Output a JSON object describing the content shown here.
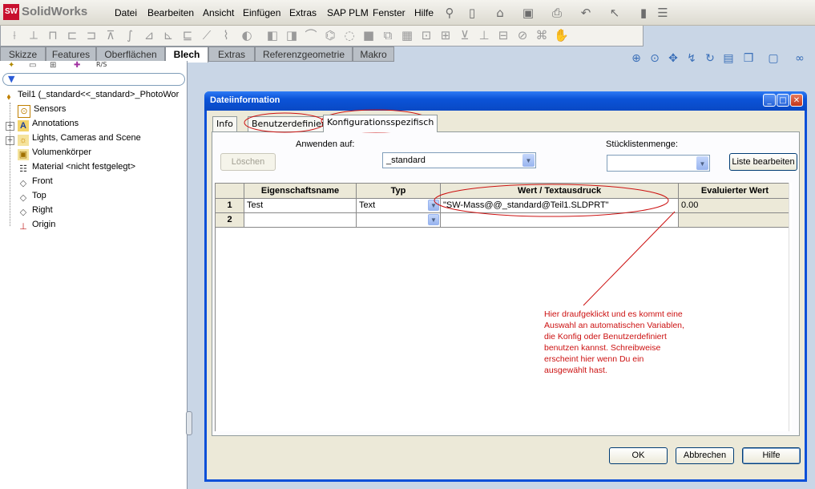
{
  "app": {
    "logo_text": "SolidWorks",
    "logo_mark": "SW"
  },
  "menu": [
    "Datei",
    "Bearbeiten",
    "Ansicht",
    "Einfügen",
    "Extras",
    "SAP PLM",
    "Fenster",
    "Hilfe"
  ],
  "command_tabs": [
    "Skizze",
    "Features",
    "Oberflächen",
    "Blech",
    "Extras",
    "Referenzgeometrie",
    "Makro"
  ],
  "command_tab_active": "Blech",
  "tree": {
    "root": "Teil1  (_standard<<_standard>_PhotoWor",
    "items": [
      {
        "label": "Sensors",
        "icon": "sensors-icon"
      },
      {
        "label": "Annotations",
        "icon": "annotations-icon"
      },
      {
        "label": "Lights, Cameras and Scene",
        "icon": "lights-icon"
      },
      {
        "label": "Volumenkörper",
        "icon": "solid-bodies-icon"
      },
      {
        "label": "Material <nicht festgelegt>",
        "icon": "material-icon"
      },
      {
        "label": "Front",
        "icon": "plane-icon"
      },
      {
        "label": "Top",
        "icon": "plane-icon"
      },
      {
        "label": "Right",
        "icon": "plane-icon"
      },
      {
        "label": "Origin",
        "icon": "origin-icon"
      }
    ]
  },
  "dialog": {
    "title": "Dateiinformation",
    "tabs": [
      "Info",
      "Benutzerdefiniert",
      "Konfigurationsspezifisch"
    ],
    "active_tab": "Konfigurationsspezifisch",
    "delete_button": "Löschen",
    "apply_to_label": "Anwenden auf:",
    "apply_to_value": "_standard",
    "bom_quantity_label": "Stücklistenmenge:",
    "bom_quantity_value": "",
    "edit_list_button": "Liste bearbeiten",
    "columns": [
      "Eigenschaftsname",
      "Typ",
      "Wert / Textausdruck",
      "Evaluierter Wert"
    ],
    "rows": [
      {
        "num": "1",
        "name": "Test",
        "type": "Text",
        "value": "\"SW-Mass@@_standard@Teil1.SLDPRT\"",
        "evaluated": "0.00"
      },
      {
        "num": "2",
        "name": "",
        "type": "",
        "value": "",
        "evaluated": ""
      }
    ],
    "ok_button": "OK",
    "cancel_button": "Abbrechen",
    "help_button": "Hilfe"
  },
  "annotation": {
    "lines": [
      "Hier draufgeklickt und es kommt eine",
      "Auswahl an automatischen Variablen,",
      "die Konfig oder Benutzerdefiniert",
      "benutzen kannst. Schreibweise",
      "erscheint hier wenn Du ein",
      "ausgewählt hast."
    ],
    "color": "#cc1111"
  }
}
